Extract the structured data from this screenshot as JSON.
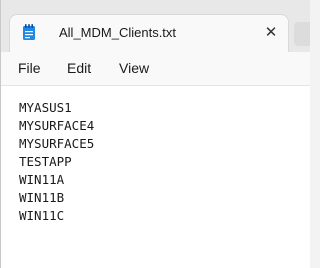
{
  "tab": {
    "title": "All_MDM_Clients.txt",
    "file_icon": "notepad-file-icon",
    "close_icon": "close-icon"
  },
  "menu": {
    "file": "File",
    "edit": "Edit",
    "view": "View"
  },
  "editor": {
    "lines": [
      "MYASUS1",
      "MYSURFACE4",
      "MYSURFACE5",
      "TESTAPP",
      "WIN11A",
      "WIN11B",
      "WIN11C"
    ]
  },
  "colors": {
    "accent": "#1976d2"
  }
}
